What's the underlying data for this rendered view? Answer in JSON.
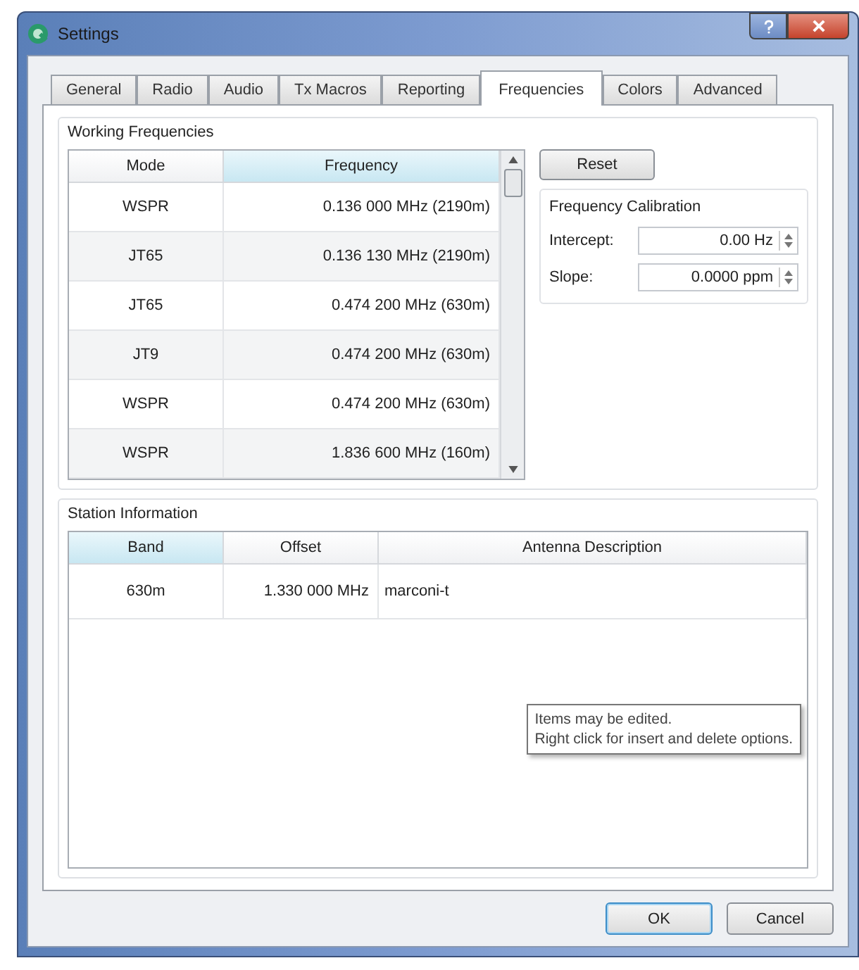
{
  "window": {
    "title": "Settings"
  },
  "tabs": [
    {
      "label": "General",
      "selected": false
    },
    {
      "label": "Radio",
      "selected": false
    },
    {
      "label": "Audio",
      "selected": false
    },
    {
      "label": "Tx Macros",
      "selected": false
    },
    {
      "label": "Reporting",
      "selected": false
    },
    {
      "label": "Frequencies",
      "selected": true
    },
    {
      "label": "Colors",
      "selected": false
    },
    {
      "label": "Advanced",
      "selected": false
    }
  ],
  "working_frequencies": {
    "title": "Working Frequencies",
    "columns": [
      {
        "label": "Mode",
        "sorted": false
      },
      {
        "label": "Frequency",
        "sorted": true
      }
    ],
    "rows": [
      [
        "WSPR",
        "0.136 000 MHz (2190m)"
      ],
      [
        "JT65",
        "0.136 130 MHz (2190m)"
      ],
      [
        "JT65",
        "0.474 200 MHz (630m)"
      ],
      [
        "JT9",
        "0.474 200 MHz (630m)"
      ],
      [
        "WSPR",
        "0.474 200 MHz (630m)"
      ],
      [
        "WSPR",
        "1.836 600 MHz (160m)"
      ]
    ],
    "reset_button": "Reset",
    "calibration": {
      "title": "Frequency Calibration",
      "fields": [
        {
          "label": "Intercept:",
          "value": "0.00 Hz"
        },
        {
          "label": "Slope:",
          "value": "0.0000 ppm"
        }
      ]
    }
  },
  "station_information": {
    "title": "Station Information",
    "columns": [
      {
        "label": "Band",
        "sorted": true
      },
      {
        "label": "Offset",
        "sorted": false
      },
      {
        "label": "Antenna Description",
        "sorted": false
      }
    ],
    "rows": [
      [
        "630m",
        "1.330 000 MHz",
        "marconi-t"
      ]
    ],
    "tooltip": [
      "Items may be edited.",
      "Right click for insert and delete options."
    ]
  },
  "buttons": [
    "OK",
    "Cancel"
  ]
}
